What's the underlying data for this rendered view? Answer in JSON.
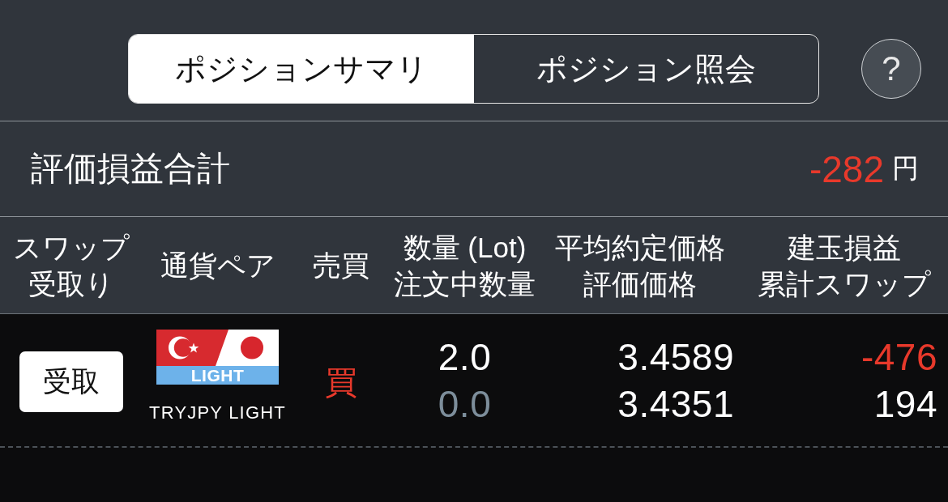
{
  "tabs": [
    {
      "label": "ポジションサマリ",
      "selected": true
    },
    {
      "label": "ポジション照会",
      "selected": false
    }
  ],
  "help": {
    "label": "?"
  },
  "summary": {
    "label": "評価損益合計",
    "value": "-282",
    "negative": true,
    "unit": "円"
  },
  "table": {
    "columns": [
      {
        "lines": [
          "スワップ",
          "受取り"
        ]
      },
      {
        "lines": [
          "通貨ペア"
        ]
      },
      {
        "lines": [
          "売買"
        ]
      },
      {
        "lines": [
          "数量 (Lot)",
          "注文中数量"
        ]
      },
      {
        "lines": [
          "平均約定価格",
          "評価価格"
        ]
      },
      {
        "lines": [
          "建玉損益",
          "累計スワップ"
        ]
      }
    ],
    "rows": [
      {
        "swap_button": "受取",
        "pair": {
          "badge": "LIGHT",
          "name": "TRYJPY LIGHT"
        },
        "side": {
          "label": "買",
          "kind": "buy"
        },
        "quantity": {
          "text": "2.0",
          "negative": false,
          "dimmed": false
        },
        "pending_quantity": {
          "text": "0.0",
          "negative": false,
          "dimmed": true
        },
        "average_price": {
          "text": "3.4589",
          "negative": false,
          "dimmed": false
        },
        "valuation_price": {
          "text": "3.4351",
          "negative": false,
          "dimmed": false
        },
        "position_pl": {
          "text": "-476",
          "negative": true,
          "dimmed": false
        },
        "cumulative_swap": {
          "text": "194",
          "negative": false,
          "dimmed": false
        }
      }
    ]
  }
}
